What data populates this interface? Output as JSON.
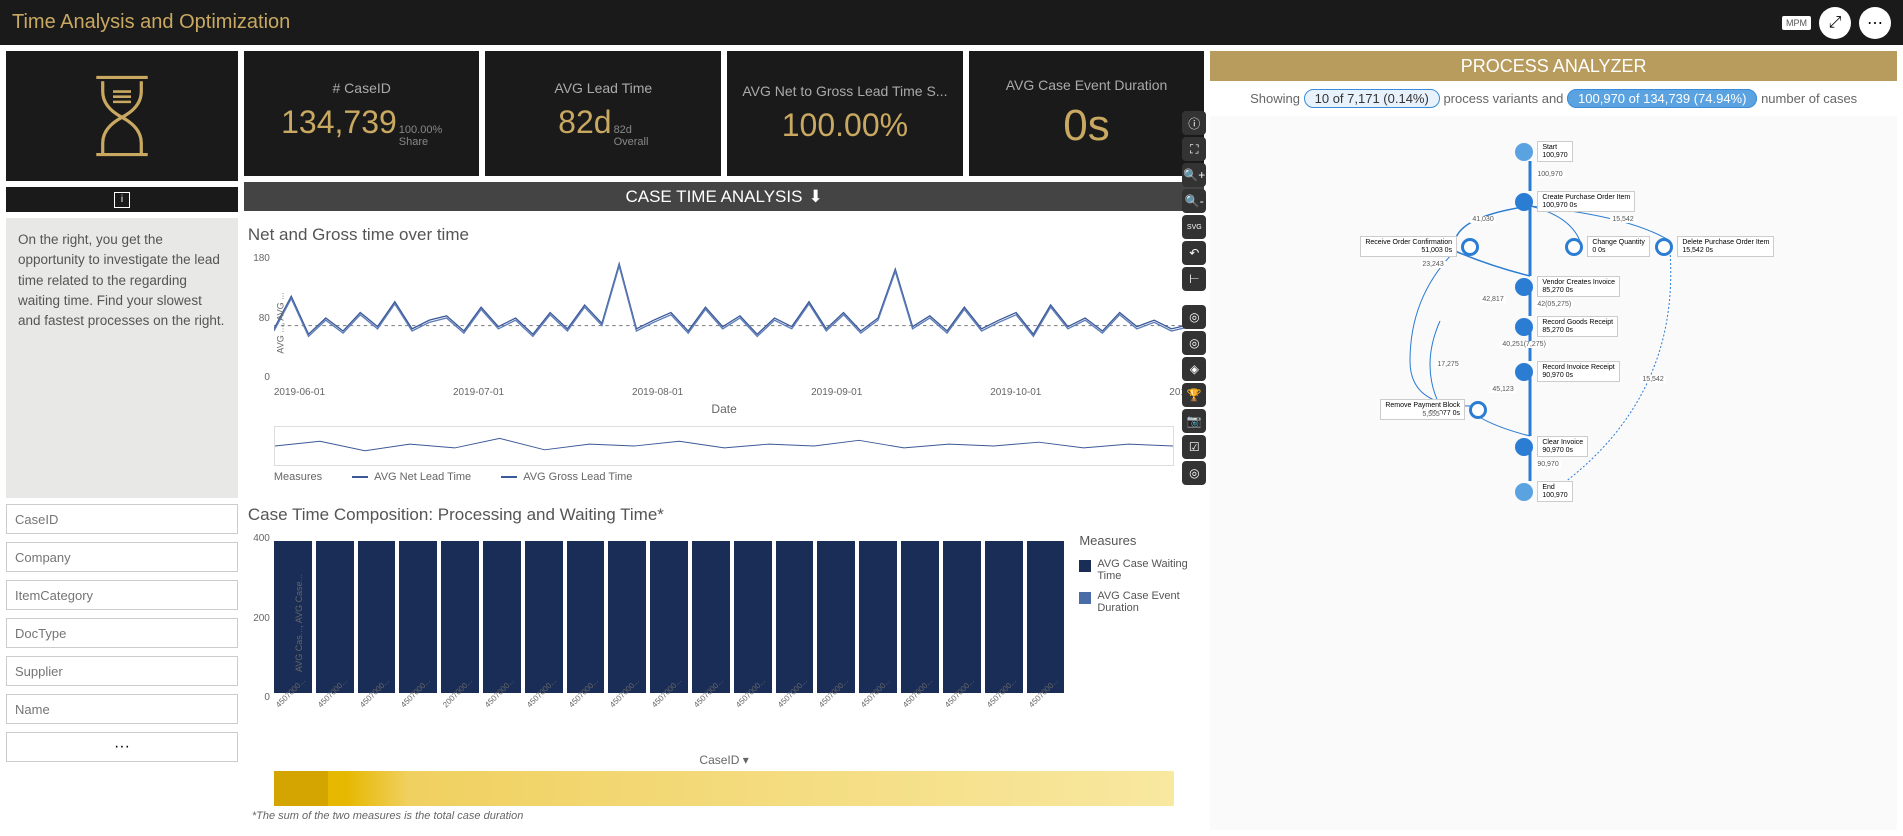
{
  "header": {
    "title": "Time Analysis and Optimization",
    "mpm": "MPM"
  },
  "kpis": [
    {
      "label": "# CaseID",
      "value": "134,739",
      "sub1": "100.00%",
      "sub2": "Share"
    },
    {
      "label": "AVG Lead Time",
      "value": "82d",
      "sub1": "82d",
      "sub2": "Overall"
    },
    {
      "label": "AVG Net to Gross Lead Time S...",
      "value": "100.00%",
      "sub1": "",
      "sub2": ""
    },
    {
      "label": "AVG Case Event Duration",
      "value": "0s",
      "sub1": "",
      "sub2": ""
    }
  ],
  "description": "On the right, you get the opportunity to investigate the lead time related to the regarding waiting time. Find your slowest and fastest processes on the right.",
  "filters": [
    "CaseID",
    "Company",
    "ItemCategory",
    "DocType",
    "Supplier",
    "Name"
  ],
  "more": "···",
  "section_header": "CASE TIME ANALYSIS",
  "chart1": {
    "title": "Net and Gross time over time",
    "ylabel": "AVG ..., AVG ...",
    "yticks": [
      "180",
      "80",
      "0"
    ],
    "xticks": [
      "2019-06-01",
      "2019-07-01",
      "2019-08-01",
      "2019-09-01",
      "2019-10-01",
      "201..."
    ],
    "date_label": "Date",
    "legend_label": "Measures",
    "legend": [
      "AVG  Net Lead Time",
      "AVG  Gross Lead Time"
    ]
  },
  "chart2": {
    "title": "Case Time Composition: Processing and Waiting Time*",
    "ylabel": "AVG Cas..., AVG Case...",
    "yticks": [
      "400",
      "200",
      "0"
    ],
    "legend_title": "Measures",
    "legend": [
      "AVG Case Waiting Time",
      "AVG Case Event Duration"
    ],
    "xlabel": "CaseID",
    "footnote": "*The sum of the two measures is the total case duration",
    "bar_labels": [
      "4507000...",
      "4507000...",
      "4507000...",
      "4507000...",
      "2007000...",
      "4507000...",
      "4507000...",
      "4507000...",
      "4507000...",
      "4507000...",
      "4507000...",
      "4507000...",
      "4507000...",
      "4507000...",
      "4507000...",
      "4507000...",
      "4507000...",
      "4507000...",
      "4507000..."
    ]
  },
  "process": {
    "header": "PROCESS ANALYZER",
    "info_pre": "Showing",
    "pill1": "10 of 7,171 (0.14%)",
    "info_mid": "process variants and",
    "pill2": "100,970 of 134,739 (74.94%)",
    "info_post": "number of cases",
    "nodes": {
      "start": {
        "name": "Start",
        "sub": "100,970"
      },
      "create": {
        "name": "Create Purchase Order Item",
        "sub": "100,970   0s"
      },
      "confirm": {
        "name": "Receive Order Confirmation",
        "sub": "51,003   0s"
      },
      "change": {
        "name": "Change Quantity",
        "sub": "0   0s"
      },
      "delete": {
        "name": "Delete Purchase Order Item",
        "sub": "15,542   0s"
      },
      "vendor": {
        "name": "Vendor Creates Invoice",
        "sub": "85,270   0s"
      },
      "goods": {
        "name": "Record Goods Receipt",
        "sub": "85,270   0s"
      },
      "invoice": {
        "name": "Record Invoice Receipt",
        "sub": "90,970   0s"
      },
      "payment": {
        "name": "Remove Payment Block",
        "sub": "51,077   0s"
      },
      "clear": {
        "name": "Clear Invoice",
        "sub": "90,970   0s"
      },
      "end": {
        "name": "End",
        "sub": "100,970"
      }
    },
    "edges": {
      "e1": "100,970",
      "e2": "41,030",
      "e3": "23,243",
      "e4": "15,542",
      "e5": "42,817",
      "e6": "17,275",
      "e7": "5,555",
      "e8": "45,123",
      "e9": "42(05,275)",
      "e10": "40,251(7,275)",
      "e11": "45,123",
      "e12": "90,970",
      "e13": "15,542"
    }
  },
  "chart_data": {
    "line_chart": {
      "type": "line",
      "title": "Net and Gross time over time",
      "xlabel": "Date",
      "ylabel": "AVG ..., AVG ...",
      "ylim": [
        0,
        180
      ],
      "x_range": [
        "2019-05",
        "2019-10"
      ],
      "series": [
        {
          "name": "AVG Net Lead Time",
          "approx_mean": 80,
          "note": "oscillating ~60-180"
        },
        {
          "name": "AVG Gross Lead Time",
          "approx_mean": 80,
          "note": "oscillating ~60-180, overlaps net"
        }
      ]
    },
    "bar_chart": {
      "type": "bar",
      "title": "Case Time Composition: Processing and Waiting Time*",
      "xlabel": "CaseID",
      "ylim": [
        0,
        400
      ],
      "categories": [
        "4507000...",
        "4507000...",
        "4507000...",
        "4507000...",
        "2007000...",
        "4507000...",
        "4507000...",
        "4507000...",
        "4507000...",
        "4507000...",
        "4507000...",
        "4507000...",
        "4507000...",
        "4507000...",
        "4507000...",
        "4507000...",
        "4507000...",
        "4507000...",
        "4507000..."
      ],
      "series": [
        {
          "name": "AVG Case Waiting Time",
          "values": [
            380,
            380,
            380,
            380,
            380,
            380,
            380,
            380,
            380,
            380,
            380,
            380,
            380,
            380,
            380,
            380,
            380,
            380,
            380
          ]
        },
        {
          "name": "AVG Case Event Duration",
          "values": [
            0,
            0,
            0,
            0,
            0,
            0,
            0,
            0,
            0,
            0,
            0,
            0,
            0,
            0,
            0,
            0,
            0,
            0,
            0
          ]
        }
      ]
    }
  }
}
